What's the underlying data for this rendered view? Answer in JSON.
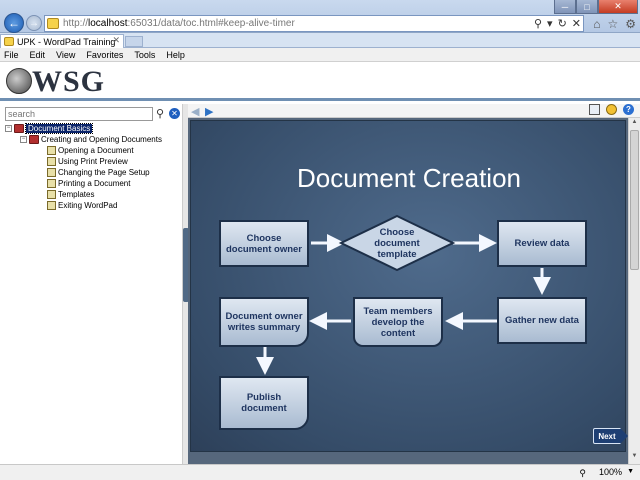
{
  "browser": {
    "url_prefix": "http://",
    "url_host": "localhost",
    "url_rest": ":65031/data/toc.html#keep-alive-timer",
    "tab_title": "UPK - WordPad Training",
    "menu": [
      "File",
      "Edit",
      "View",
      "Favorites",
      "Tools",
      "Help"
    ],
    "zoom": "100%"
  },
  "logo": {
    "text": "WSG"
  },
  "search": {
    "placeholder": "search"
  },
  "tree": {
    "root": "Document Basics",
    "group": "Creating and Opening Documents",
    "items": [
      "Opening a Document",
      "Using Print Preview",
      "Changing the Page Setup",
      "Printing a Document",
      "Templates",
      "Exiting WordPad"
    ]
  },
  "slide": {
    "title": "Document Creation",
    "boxes": {
      "choose_owner": "Choose document owner",
      "choose_template": "Choose document template",
      "review_data": "Review data",
      "gather_new_data": "Gather new data",
      "team_members": "Team members develop the content",
      "owner_writes": "Document owner writes summary",
      "publish": "Publish document"
    },
    "next_label": "Next"
  },
  "colors": {
    "slide_bg": "#3f5876",
    "box_fill": "#c9d6e6",
    "box_text": "#1f3560",
    "selected_bg": "#0a246a"
  }
}
